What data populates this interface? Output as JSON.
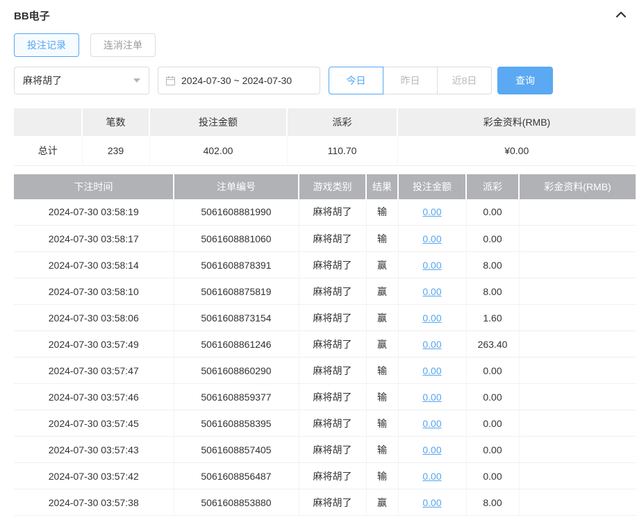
{
  "panel": {
    "title": "BB电子"
  },
  "tabs": [
    {
      "label": "投注记录",
      "active": true
    },
    {
      "label": "连消注单",
      "active": false
    }
  ],
  "filters": {
    "game_select": {
      "value": "麻将胡了"
    },
    "date_range": {
      "value": "2024-07-30 ~ 2024-07-30"
    },
    "quick_ranges": [
      {
        "label": "今日",
        "active": true
      },
      {
        "label": "昨日",
        "active": false
      },
      {
        "label": "近8日",
        "active": false
      }
    ],
    "search_button": "查询"
  },
  "summary": {
    "headers": [
      "",
      "笔数",
      "投注金额",
      "派彩",
      "彩金资料(RMB)"
    ],
    "total_row": {
      "label": "总计",
      "count": "239",
      "bet_amount": "402.00",
      "payout": "110.70",
      "bonus": "¥0.00"
    }
  },
  "records": {
    "headers": [
      "下注时间",
      "注单编号",
      "游戏类别",
      "结果",
      "投注金额",
      "派彩",
      "彩金资料(RMB)"
    ],
    "rows": [
      {
        "time": "2024-07-30 03:58:19",
        "order_no": "5061608881990",
        "game": "麻将胡了",
        "result": "输",
        "bet": "0.00",
        "payout": "0.00",
        "bonus": ""
      },
      {
        "time": "2024-07-30 03:58:17",
        "order_no": "5061608881060",
        "game": "麻将胡了",
        "result": "输",
        "bet": "0.00",
        "payout": "0.00",
        "bonus": ""
      },
      {
        "time": "2024-07-30 03:58:14",
        "order_no": "5061608878391",
        "game": "麻将胡了",
        "result": "赢",
        "bet": "0.00",
        "payout": "8.00",
        "bonus": ""
      },
      {
        "time": "2024-07-30 03:58:10",
        "order_no": "5061608875819",
        "game": "麻将胡了",
        "result": "赢",
        "bet": "0.00",
        "payout": "8.00",
        "bonus": ""
      },
      {
        "time": "2024-07-30 03:58:06",
        "order_no": "5061608873154",
        "game": "麻将胡了",
        "result": "赢",
        "bet": "0.00",
        "payout": "1.60",
        "bonus": ""
      },
      {
        "time": "2024-07-30 03:57:49",
        "order_no": "5061608861246",
        "game": "麻将胡了",
        "result": "赢",
        "bet": "0.00",
        "payout": "263.40",
        "bonus": ""
      },
      {
        "time": "2024-07-30 03:57:47",
        "order_no": "5061608860290",
        "game": "麻将胡了",
        "result": "输",
        "bet": "0.00",
        "payout": "0.00",
        "bonus": ""
      },
      {
        "time": "2024-07-30 03:57:46",
        "order_no": "5061608859377",
        "game": "麻将胡了",
        "result": "输",
        "bet": "0.00",
        "payout": "0.00",
        "bonus": ""
      },
      {
        "time": "2024-07-30 03:57:45",
        "order_no": "5061608858395",
        "game": "麻将胡了",
        "result": "输",
        "bet": "0.00",
        "payout": "0.00",
        "bonus": ""
      },
      {
        "time": "2024-07-30 03:57:43",
        "order_no": "5061608857405",
        "game": "麻将胡了",
        "result": "输",
        "bet": "0.00",
        "payout": "0.00",
        "bonus": ""
      },
      {
        "time": "2024-07-30 03:57:42",
        "order_no": "5061608856487",
        "game": "麻将胡了",
        "result": "输",
        "bet": "0.00",
        "payout": "0.00",
        "bonus": ""
      },
      {
        "time": "2024-07-30 03:57:38",
        "order_no": "5061608853880",
        "game": "麻将胡了",
        "result": "赢",
        "bet": "0.00",
        "payout": "8.00",
        "bonus": ""
      }
    ]
  },
  "colors": {
    "accent": "#55a5f0",
    "link": "#55a5f0",
    "records_header_bg": "#b0b2b6",
    "summary_header_bg": "#efeff0"
  }
}
